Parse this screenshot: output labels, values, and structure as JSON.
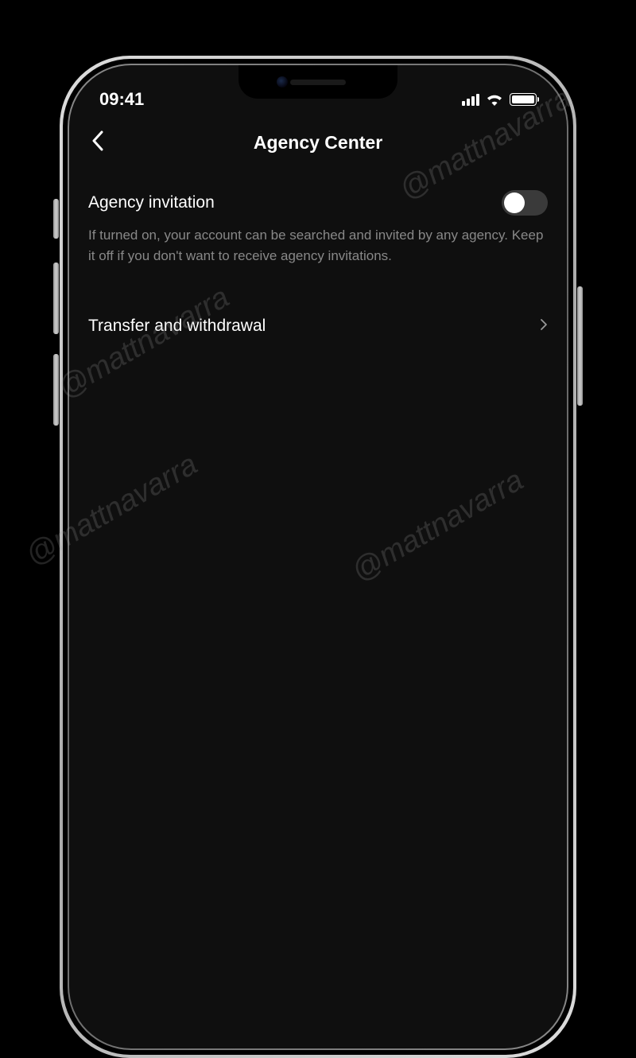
{
  "status": {
    "time": "09:41"
  },
  "header": {
    "title": "Agency Center"
  },
  "settings": {
    "invitation": {
      "title": "Agency invitation",
      "description": "If turned on, your account can be searched and invited by any agency. Keep it off if you don't want to receive agency invitations."
    }
  },
  "nav": {
    "transfer": {
      "title": "Transfer and withdrawal"
    }
  },
  "watermark": "@mattnavarra"
}
